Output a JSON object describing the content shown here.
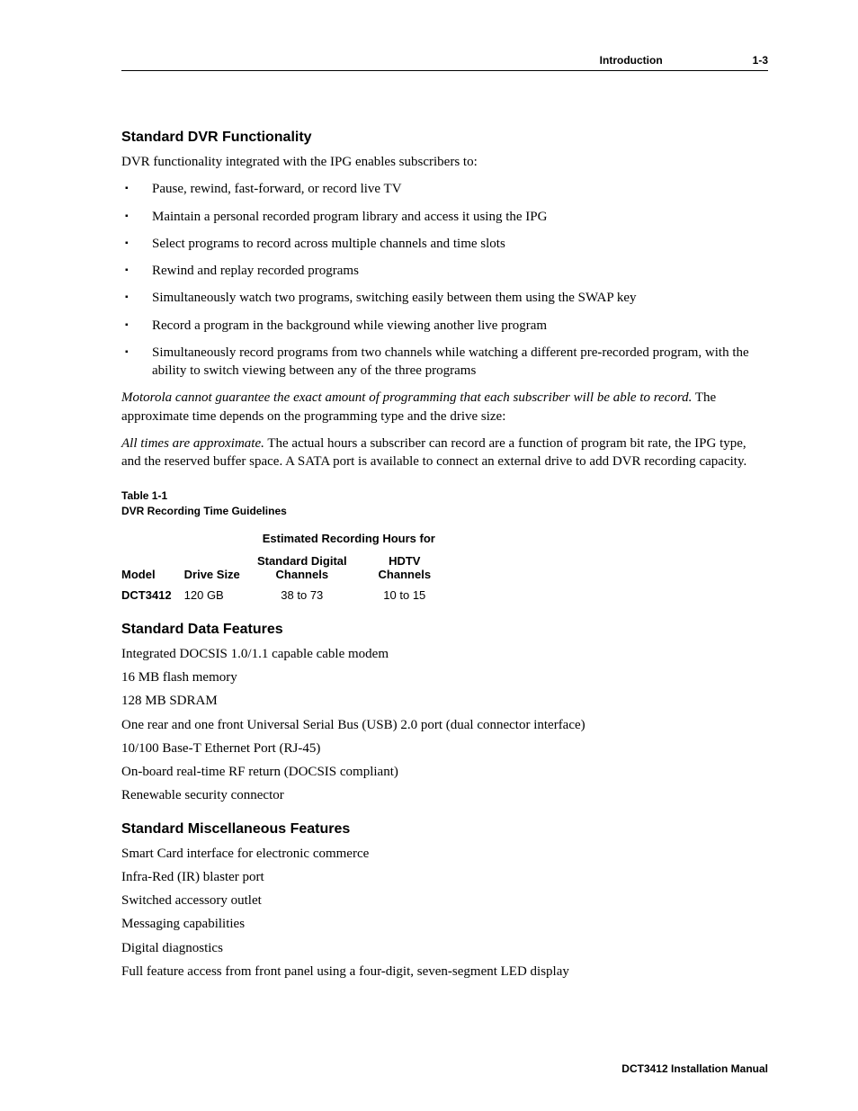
{
  "header": {
    "section": "Introduction",
    "page": "1-3"
  },
  "dvr": {
    "title": "Standard DVR Functionality",
    "intro": "DVR functionality integrated with the IPG enables subscribers to:",
    "bullets": [
      "Pause, rewind, fast-forward, or record live TV",
      "Maintain a personal recorded program library and access it using the IPG",
      "Select programs to record across multiple channels and time slots",
      "Rewind and replay recorded programs",
      "Simultaneously watch two programs, switching easily between them using the SWAP key",
      "Record a program in the background while viewing another live program",
      "Simultaneously record programs from two channels while watching a different pre-recorded program, with the ability to switch viewing between any of the three programs"
    ],
    "note1_em": "Motorola cannot guarantee the exact amount of programming that each subscriber will be able to record.",
    "note1_rest": " The approximate time depends on the programming type and the drive size:",
    "note2_em": "All times are approximate.",
    "note2_rest": " The actual hours a subscriber can record are a function of program bit rate, the IPG type, and the reserved buffer space. A SATA port is available to connect an external drive to add DVR recording capacity."
  },
  "table": {
    "label1": "Table 1-1",
    "label2": "DVR Recording Time Guidelines",
    "span_header": "Estimated Recording Hours for",
    "col_model": "Model",
    "col_drive": "Drive Size",
    "col_std": "Standard Digital Channels",
    "col_hdtv": "HDTV Channels",
    "row": {
      "model": "DCT3412",
      "drive": "120 GB",
      "std": "38 to 73",
      "hdtv": "10 to 15"
    }
  },
  "chart_data": {
    "type": "table",
    "title": "DVR Recording Time Guidelines",
    "columns": [
      "Model",
      "Drive Size",
      "Standard Digital Channels (hrs)",
      "HDTV Channels (hrs)"
    ],
    "rows": [
      {
        "Model": "DCT3412",
        "Drive Size": "120 GB",
        "Standard Digital Channels (hrs)": "38 to 73",
        "HDTV Channels (hrs)": "10 to 15"
      }
    ]
  },
  "data_features": {
    "title": "Standard Data Features",
    "items": [
      "Integrated DOCSIS 1.0/1.1 capable cable modem",
      "16 MB flash memory",
      "128 MB SDRAM",
      "One rear and one front Universal Serial Bus (USB) 2.0 port (dual connector interface)",
      "10/100 Base-T Ethernet Port (RJ-45)",
      "On-board real-time RF return (DOCSIS compliant)",
      "Renewable security connector"
    ]
  },
  "misc_features": {
    "title": "Standard Miscellaneous Features",
    "items": [
      "Smart Card interface for electronic commerce",
      "Infra-Red (IR) blaster port",
      "Switched accessory outlet",
      "Messaging capabilities",
      "Digital diagnostics",
      "Full feature access from front panel using a four-digit, seven-segment LED display"
    ]
  },
  "footer": "DCT3412 Installation Manual"
}
